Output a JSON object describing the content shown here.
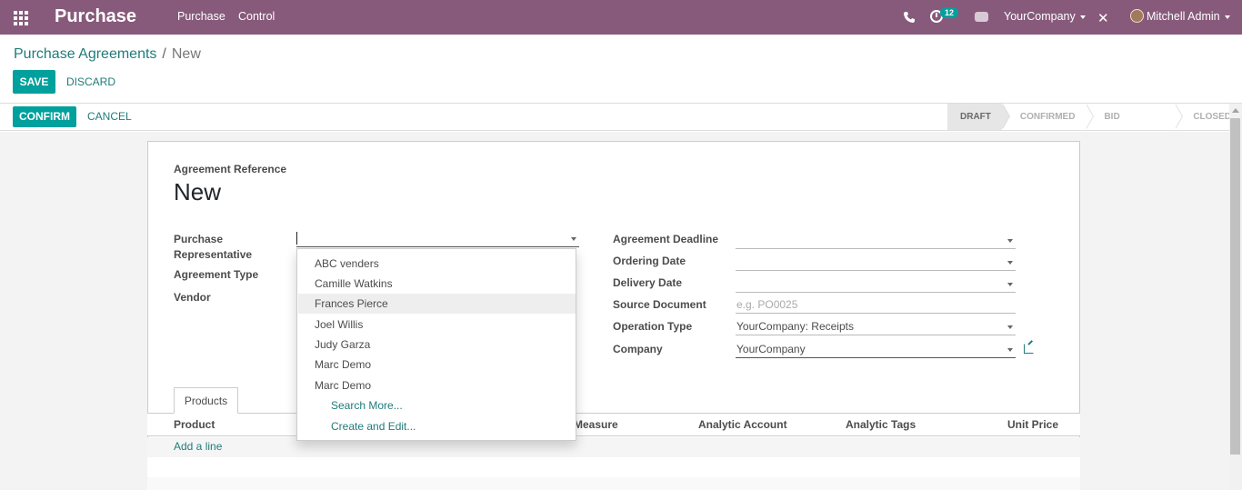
{
  "navbar": {
    "app_name": "Purchase",
    "menu": [
      "Purchase",
      "Control"
    ],
    "activity_count": "12",
    "company": "YourCompany",
    "user": "Mitchell Admin",
    "icons": [
      "apps-icon",
      "phone-icon",
      "activity-icon",
      "chat-icon",
      "debug-icon"
    ]
  },
  "breadcrumb": {
    "parent": "Purchase Agreements",
    "separator": "/",
    "current": "New"
  },
  "buttons": {
    "save": "SAVE",
    "discard": "DISCARD",
    "confirm": "CONFIRM",
    "cancel": "CANCEL"
  },
  "stages": [
    "DRAFT",
    "CONFIRMED",
    "BID SELECTION",
    "CLOSED"
  ],
  "active_stage": "DRAFT",
  "form": {
    "reference_label": "Agreement Reference",
    "reference_value": "New",
    "left": {
      "purchase_rep_label_line1": "Purchase",
      "purchase_rep_label_line2": "Representative",
      "agreement_type_label": "Agreement Type",
      "vendor_label": "Vendor"
    },
    "right": {
      "deadline_label": "Agreement Deadline",
      "ordering_date_label": "Ordering Date",
      "delivery_date_label": "Delivery Date",
      "source_document_label": "Source Document",
      "source_document_placeholder": "e.g. PO0025",
      "operation_type_label": "Operation Type",
      "operation_type_value": "YourCompany: Receipts",
      "company_label": "Company",
      "company_value": "YourCompany"
    }
  },
  "dropdown": {
    "items": [
      "ABC venders",
      "Camille Watkins",
      "Frances Pierce",
      "Joel Willis",
      "Judy Garza",
      "Marc Demo",
      "Marc Demo"
    ],
    "highlighted": "Frances Pierce",
    "search_more": "Search More...",
    "create_edit": "Create and Edit..."
  },
  "tabs": [
    "Products"
  ],
  "table": {
    "columns": [
      "Product",
      "Measure",
      "Analytic Account",
      "Analytic Tags",
      "Unit Price"
    ],
    "add_line": "Add a line"
  },
  "colors": {
    "navbar": "#875a7b",
    "primary": "#00a09d",
    "link": "#1f7c7a"
  }
}
